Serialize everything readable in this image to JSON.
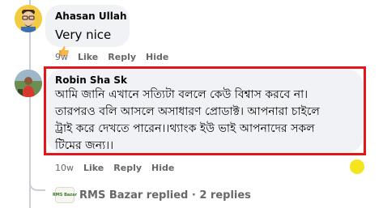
{
  "comments": [
    {
      "author": "Ahasan Ullah",
      "text": "Very nice",
      "time": "9w",
      "actions": [
        "Like",
        "Reply",
        "Hide"
      ]
    },
    {
      "author": "Robin Sha Sk",
      "lines": [
        "আমি জানি এখানে সত্যিটা বললে কেউ বিশ্বাস করবে না।",
        "তারপরও বলি আসলে অসাধারণ প্রোডাক্ট। আপনারা চাইলে",
        "ট্রাই করে দেখতে পারেন।।থ্যাংক ইউ ভাই আপনাদের সকল",
        "টিমের জন্য।।"
      ],
      "time": "10w",
      "actions": [
        "Like",
        "Reply",
        "Hide"
      ]
    }
  ],
  "replies": {
    "logo_text": "RMS Bazar",
    "summary": "RMS Bazar replied · 2 replies"
  },
  "colors": {
    "highlight": "#e4161b",
    "marker": "#f4e51c",
    "bubble": "#f0f2f5"
  }
}
